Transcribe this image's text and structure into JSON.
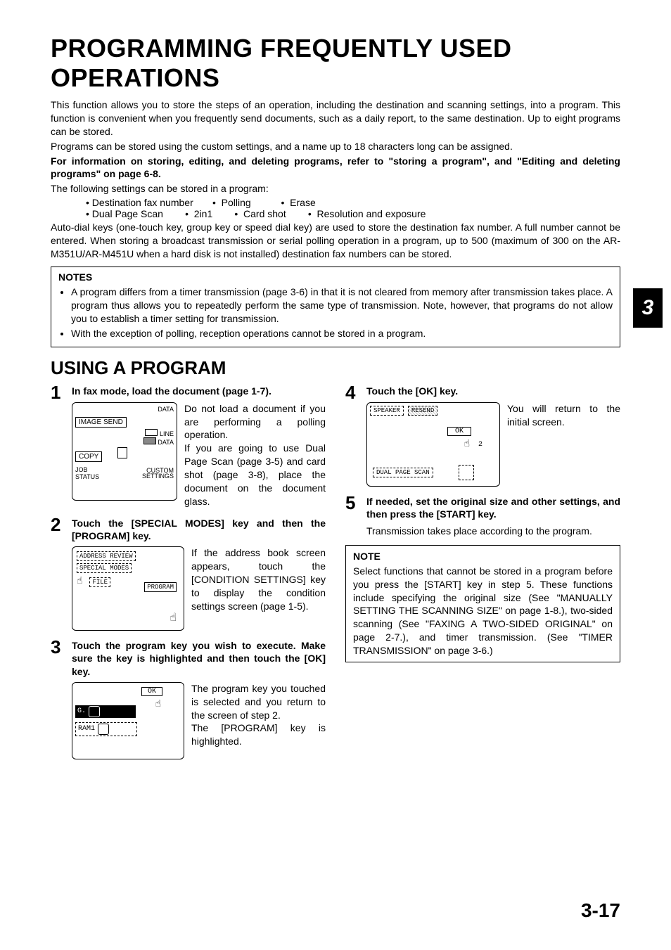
{
  "side_tab": "3",
  "page_number": "3-17",
  "h1": "PROGRAMMING FREQUENTLY USED OPERATIONS",
  "intro": {
    "p1": "This function allows you to store the steps of an operation, including the destination and scanning settings, into a program. This function is convenient when you frequently send documents, such as a daily report, to the same destination. Up to eight programs can be stored.",
    "p2": "Programs can be stored using the custom settings, and a name up to 18 characters long can be assigned.",
    "p3": "For information on storing, editing, and deleting programs, refer to \"storing a program\", and \"Editing and deleting programs\" on page 6-8.",
    "p4": "The following settings can be stored in a program:",
    "row1": "• Destination fax number       •  Polling           •  Erase",
    "row2": "• Dual Page Scan        •  2in1        •  Card shot        •  Resolution and exposure",
    "p5": "Auto-dial keys (one-touch key, group key or speed dial key) are used to store the destination fax number. A full number cannot be entered. When storing a broadcast transmission or serial polling operation in a program, up to 500 (maximum of 300 on the AR-M351U/AR-M451U when a hard disk is not installed) destination fax numbers can be stored."
  },
  "notes": {
    "title": "NOTES",
    "b1": "A program differs from a timer transmission (page 3-6) in that it is not cleared from memory after transmission takes place. A program thus allows you to repeatedly perform the same type of transmission. Note, however, that programs do not allow you to establish a timer setting for transmission.",
    "b2": "With the exception of polling, reception operations cannot be stored in a program."
  },
  "h2": "USING A PROGRAM",
  "steps": {
    "s1": {
      "num": "1",
      "title": "In fax mode, load the document (page 1-7).",
      "text": "Do not load a document if you are performing a polling operation.\nIf you are going to use Dual Page Scan (page 3-5) and card shot (page 3-8), place the document on the document glass.",
      "il": {
        "data": "DATA",
        "image_send": "IMAGE SEND",
        "line": "LINE",
        "data2": "DATA",
        "copy": "COPY",
        "job_status": "JOB STATUS",
        "custom": "CUSTOM SETTINGS"
      }
    },
    "s2": {
      "num": "2",
      "title": "Touch the [SPECIAL MODES] key and then the [PROGRAM] key.",
      "text": "If the address book screen appears, touch the [CONDITION SETTINGS] key to display the condition settings screen (page 1-5).",
      "il": {
        "addr": "ADDRESS REVIEW",
        "spec": "SPECIAL MODES",
        "file": "FILE",
        "prog": "PROGRAM"
      }
    },
    "s3": {
      "num": "3",
      "title": "Touch the program key you wish to execute. Make sure the key is highlighted and then touch the [OK] key.",
      "text": "The program key you touched is selected and you return to the screen of step 2.\nThe [PROGRAM] key is highlighted.",
      "il": {
        "ok": "OK",
        "g": "G.",
        "ram": "RAM1"
      }
    },
    "s4": {
      "num": "4",
      "title": "Touch the [OK] key.",
      "text": "You will return to the initial screen.",
      "il": {
        "speaker": "SPEAKER",
        "resend": "RESEND",
        "ok": "OK",
        "two": "2",
        "dual": "DUAL PAGE SCAN"
      }
    },
    "s5": {
      "num": "5",
      "title": "If needed, set the original size and other settings, and then press the [START] key.",
      "text": "Transmission takes place according to the program."
    }
  },
  "note2": {
    "title": "NOTE",
    "text": "Select functions that cannot be stored in a program before you press the [START] key in step 5. These functions include specifying the original size (See \"MANUALLY SETTING THE SCANNING SIZE\" on page 1-8.), two-sided scanning (See \"FAXING A TWO-SIDED ORIGINAL\" on page 2-7.), and timer transmission. (See \"TIMER TRANSMISSION\" on page 3-6.)"
  }
}
